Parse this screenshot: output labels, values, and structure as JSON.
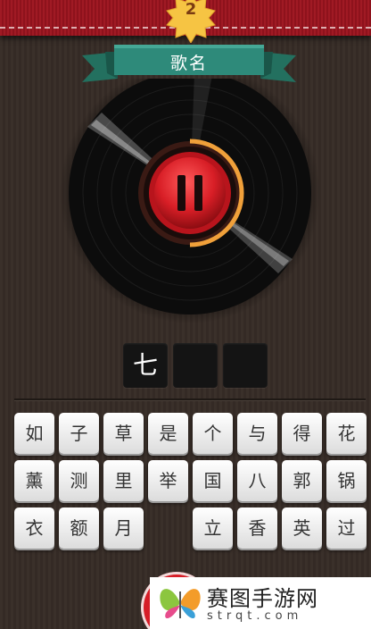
{
  "level": {
    "number": "2"
  },
  "title": {
    "label": "歌名"
  },
  "player": {
    "state": "playing",
    "control_icon": "pause-icon",
    "progress": 0.5
  },
  "answer": {
    "slots": [
      "七",
      "",
      ""
    ]
  },
  "letters": [
    [
      "如",
      "子",
      "草",
      "是",
      "个",
      "与",
      "得",
      "花"
    ],
    [
      "薰",
      "测",
      "里",
      "举",
      "国",
      "八",
      "郭",
      "锅"
    ],
    [
      "衣",
      "额",
      "月",
      "",
      "立",
      "香",
      "英",
      "过"
    ]
  ],
  "watermark": {
    "chinese": "赛图手游网",
    "latin": "strqt.com"
  },
  "colors": {
    "top_bar": "#9a1620",
    "ribbon": "#2e8a7a",
    "accent_red": "#d61d27",
    "progress_orange": "#f0a03a"
  }
}
